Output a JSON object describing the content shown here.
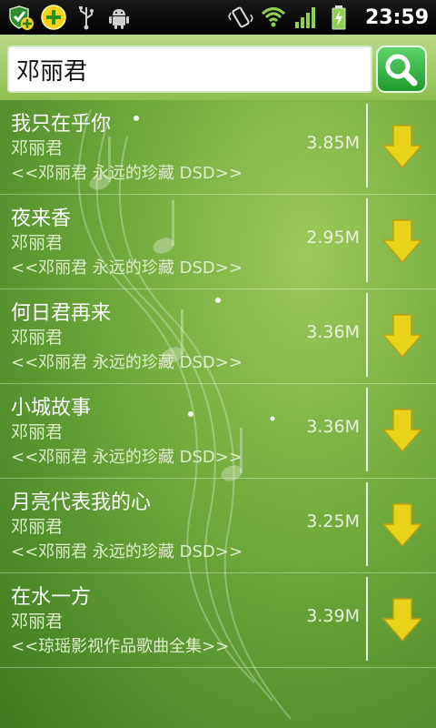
{
  "status_bar": {
    "time": "23:59",
    "left_icons": [
      "shield-plus-icon",
      "add-circle-icon",
      "usb-icon",
      "android-icon"
    ],
    "right_icons": [
      "vibrate-icon",
      "wifi-icon",
      "signal-icon",
      "battery-charging-icon"
    ]
  },
  "search": {
    "value": "邓丽君",
    "button_icon": "search-icon"
  },
  "colors": {
    "accent_yellow": "#e8d21a",
    "search_button_green": "#2bb23c",
    "background_green": "#6fa83a"
  },
  "songs": [
    {
      "title": "我只在乎你",
      "artist": "邓丽君",
      "album": "<<邓丽君 永远的珍藏 DSD>>",
      "size": "3.85M"
    },
    {
      "title": "夜来香",
      "artist": "邓丽君",
      "album": "<<邓丽君 永远的珍藏 DSD>>",
      "size": "2.95M"
    },
    {
      "title": "何日君再来",
      "artist": "邓丽君",
      "album": "<<邓丽君 永远的珍藏 DSD>>",
      "size": "3.36M"
    },
    {
      "title": "小城故事",
      "artist": "邓丽君",
      "album": "<<邓丽君 永远的珍藏 DSD>>",
      "size": "3.36M"
    },
    {
      "title": "月亮代表我的心",
      "artist": "邓丽君",
      "album": "<<邓丽君 永远的珍藏 DSD>>",
      "size": "3.25M"
    },
    {
      "title": "在水一方",
      "artist": "邓丽君",
      "album": "<<琼瑶影视作品歌曲全集>>",
      "size": "3.39M"
    }
  ]
}
